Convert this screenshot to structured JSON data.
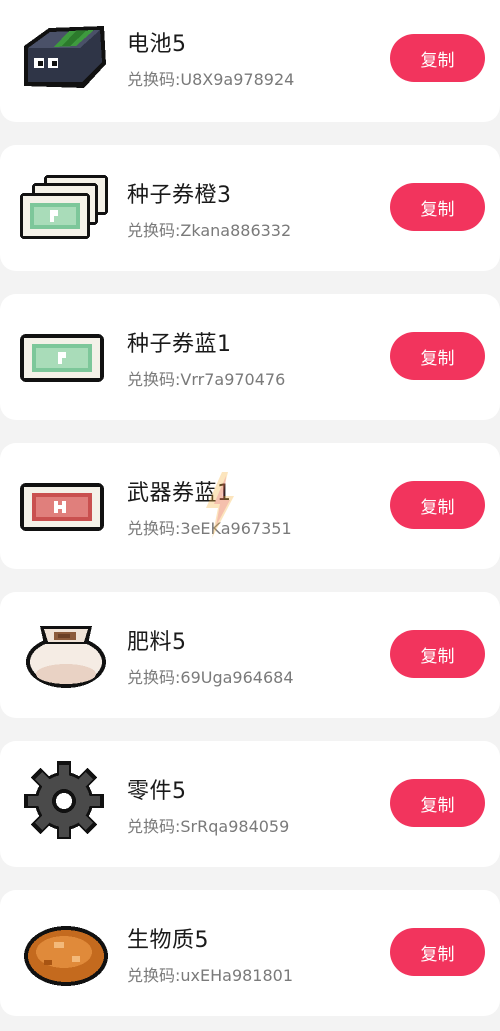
{
  "code_prefix": "兑换码:",
  "items": [
    {
      "name": "电池5",
      "code_label": "兑换码:U8X9a978924",
      "copy_label": "复制",
      "icon": "battery-icon"
    },
    {
      "name": "种子券橙3",
      "code_label": "兑换码:Zkana886332",
      "copy_label": "复制",
      "icon": "seed-ticket-stack-icon"
    },
    {
      "name": "种子券蓝1",
      "code_label": "兑换码:Vrr7a970476",
      "copy_label": "复制",
      "icon": "seed-ticket-icon"
    },
    {
      "name": "武器券蓝1",
      "code_label": "兑换码:3eEKa967351",
      "copy_label": "复制",
      "icon": "weapon-ticket-icon"
    },
    {
      "name": "肥料5",
      "code_label": "兑换码:69Uga964684",
      "copy_label": "复制",
      "icon": "fertilizer-sack-icon"
    },
    {
      "name": "零件5",
      "code_label": "兑换码:SrRqa984059",
      "copy_label": "复制",
      "icon": "gear-part-icon"
    },
    {
      "name": "生物质5",
      "code_label": "兑换码:uxEHa981801",
      "copy_label": "复制",
      "icon": "biomass-icon"
    }
  ],
  "colors": {
    "button": "#f2345d",
    "background": "#f3f3f3",
    "card": "#ffffff"
  }
}
